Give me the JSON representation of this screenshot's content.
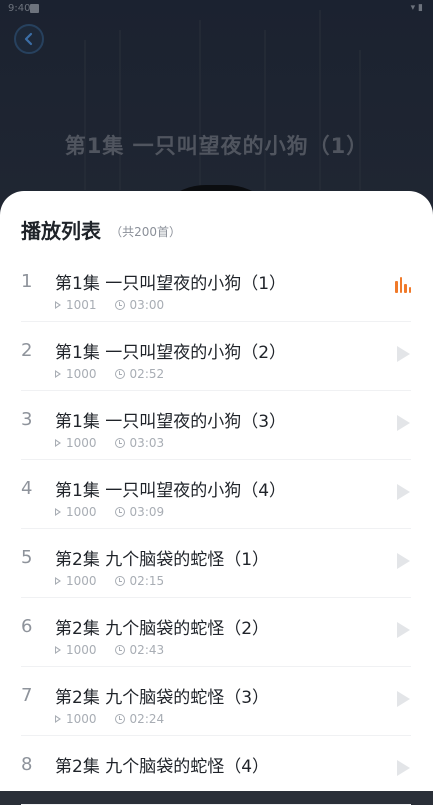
{
  "status_bar": {
    "time": "9:40"
  },
  "player": {
    "background_title": "第1集 一只叫望夜的小狗（1）"
  },
  "playlist": {
    "title": "播放列表",
    "count_label": "（共200首）",
    "tracks": [
      {
        "index": "1",
        "title": "第1集 一只叫望夜的小狗（1）",
        "plays": "1001",
        "duration": "03:00",
        "playing": true
      },
      {
        "index": "2",
        "title": "第1集 一只叫望夜的小狗（2）",
        "plays": "1000",
        "duration": "02:52",
        "playing": false
      },
      {
        "index": "3",
        "title": "第1集 一只叫望夜的小狗（3）",
        "plays": "1000",
        "duration": "03:03",
        "playing": false
      },
      {
        "index": "4",
        "title": "第1集 一只叫望夜的小狗（4）",
        "plays": "1000",
        "duration": "03:09",
        "playing": false
      },
      {
        "index": "5",
        "title": "第2集 九个脑袋的蛇怪（1）",
        "plays": "1000",
        "duration": "02:15",
        "playing": false
      },
      {
        "index": "6",
        "title": "第2集 九个脑袋的蛇怪（2）",
        "plays": "1000",
        "duration": "02:43",
        "playing": false
      },
      {
        "index": "7",
        "title": "第2集 九个脑袋的蛇怪（3）",
        "plays": "1000",
        "duration": "02:24",
        "playing": false
      },
      {
        "index": "8",
        "title": "第2集 九个脑袋的蛇怪（4）",
        "plays": "",
        "duration": "",
        "playing": false
      }
    ]
  },
  "colors": {
    "accent_playing": "#f07a2a",
    "sheet_bg": "#ffffff",
    "overlay_bg": "#222833"
  },
  "icons": {
    "back": "chevron-left-icon",
    "now_playing": "equalizer-icon",
    "play": "play-icon",
    "play_count": "play-count-icon",
    "duration": "clock-icon"
  }
}
